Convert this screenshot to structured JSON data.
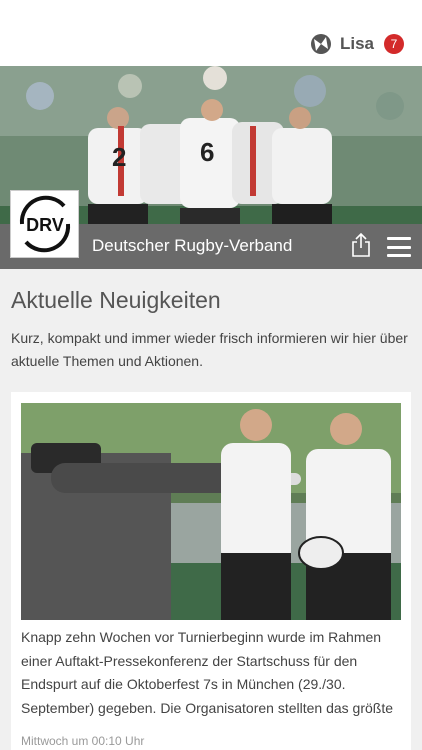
{
  "header": {
    "user_name": "Lisa",
    "notification_count": "7",
    "user_icon": "ball-icon",
    "badge_color": "#d32a2a"
  },
  "hero": {
    "image_description": "rugby-team-huddle",
    "jersey_numbers": [
      "2",
      "6"
    ]
  },
  "brand": {
    "logo_text": "DRV",
    "title": "Deutscher Rugby-Verband",
    "bar_color": "#6a6a6a",
    "share_icon": "share-icon",
    "menu_icon": "hamburger-menu-icon"
  },
  "main": {
    "section_title": "Aktuelle Neuigkeiten",
    "section_description": "Kurz, kompakt und immer wieder frisch informieren wir hier über aktuelle Themen und Aktionen."
  },
  "news": [
    {
      "image": "press-interview-photo",
      "text": "Knapp zehn Wochen vor Turnierbeginn wurde im Rahmen einer Auftakt-Pressekonferenz der Startschuss für den Endspurt auf die Oktoberfest 7s in München (29./30. September) gegeben. Die Organisatoren stellten das größte",
      "timestamp": "Mittwoch um 00:10 Uhr"
    }
  ]
}
